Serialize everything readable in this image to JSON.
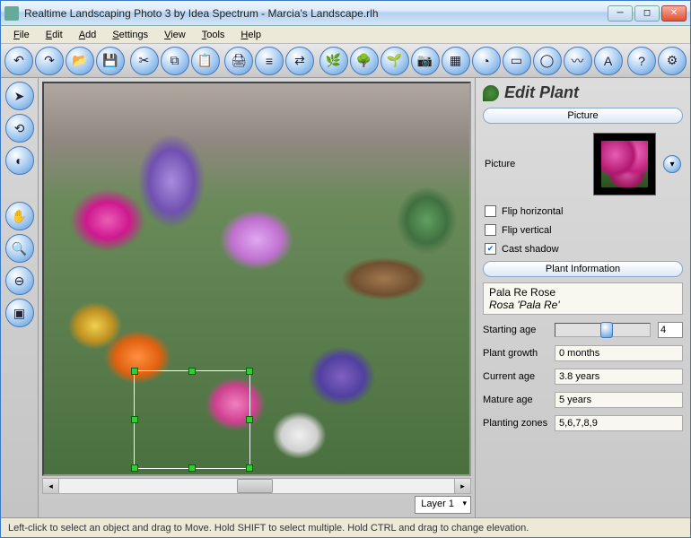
{
  "window": {
    "title": "Realtime Landscaping Photo 3 by Idea Spectrum - Marcia's Landscape.rlh"
  },
  "menu": {
    "file": "File",
    "edit": "Edit",
    "add": "Add",
    "settings": "Settings",
    "view": "View",
    "tools": "Tools",
    "help": "Help"
  },
  "toolbar_icons": [
    "undo-icon",
    "redo-icon",
    "open-icon",
    "save-icon",
    "cut-icon",
    "copy-icon",
    "paste-icon",
    "print-icon",
    "align-icon",
    "flip-icon",
    "plant-icon",
    "tree-icon",
    "shrub-icon",
    "camera-icon",
    "texture-icon",
    "rock-icon",
    "furniture-icon",
    "shape-icon",
    "path-icon",
    "text-icon",
    "help-icon",
    "settings-icon"
  ],
  "left_tools": [
    "pointer-icon",
    "rotate-icon",
    "fill-icon",
    "pan-icon",
    "zoom-in-icon",
    "zoom-out-icon",
    "fit-icon"
  ],
  "layer": {
    "label": "Layer 1"
  },
  "panel": {
    "title": "Edit Plant",
    "picture_section": "Picture",
    "picture_label": "Picture",
    "flip_h": "Flip horizontal",
    "flip_v": "Flip vertical",
    "cast_shadow": "Cast shadow",
    "flip_h_checked": false,
    "flip_v_checked": false,
    "cast_shadow_checked": true,
    "info_section": "Plant Information",
    "plant_name": "Pala Re Rose",
    "plant_sci": "Rosa 'Pala Re'",
    "starting_age_label": "Starting age",
    "starting_age_value": "4",
    "plant_growth_label": "Plant growth",
    "plant_growth_value": "0 months",
    "current_age_label": "Current age",
    "current_age_value": "3.8 years",
    "mature_age_label": "Mature age",
    "mature_age_value": "5 years",
    "zones_label": "Planting zones",
    "zones_value": "5,6,7,8,9"
  },
  "status": "Left-click to select an object and drag to Move. Hold SHIFT to select multiple. Hold CTRL and drag to change elevation."
}
